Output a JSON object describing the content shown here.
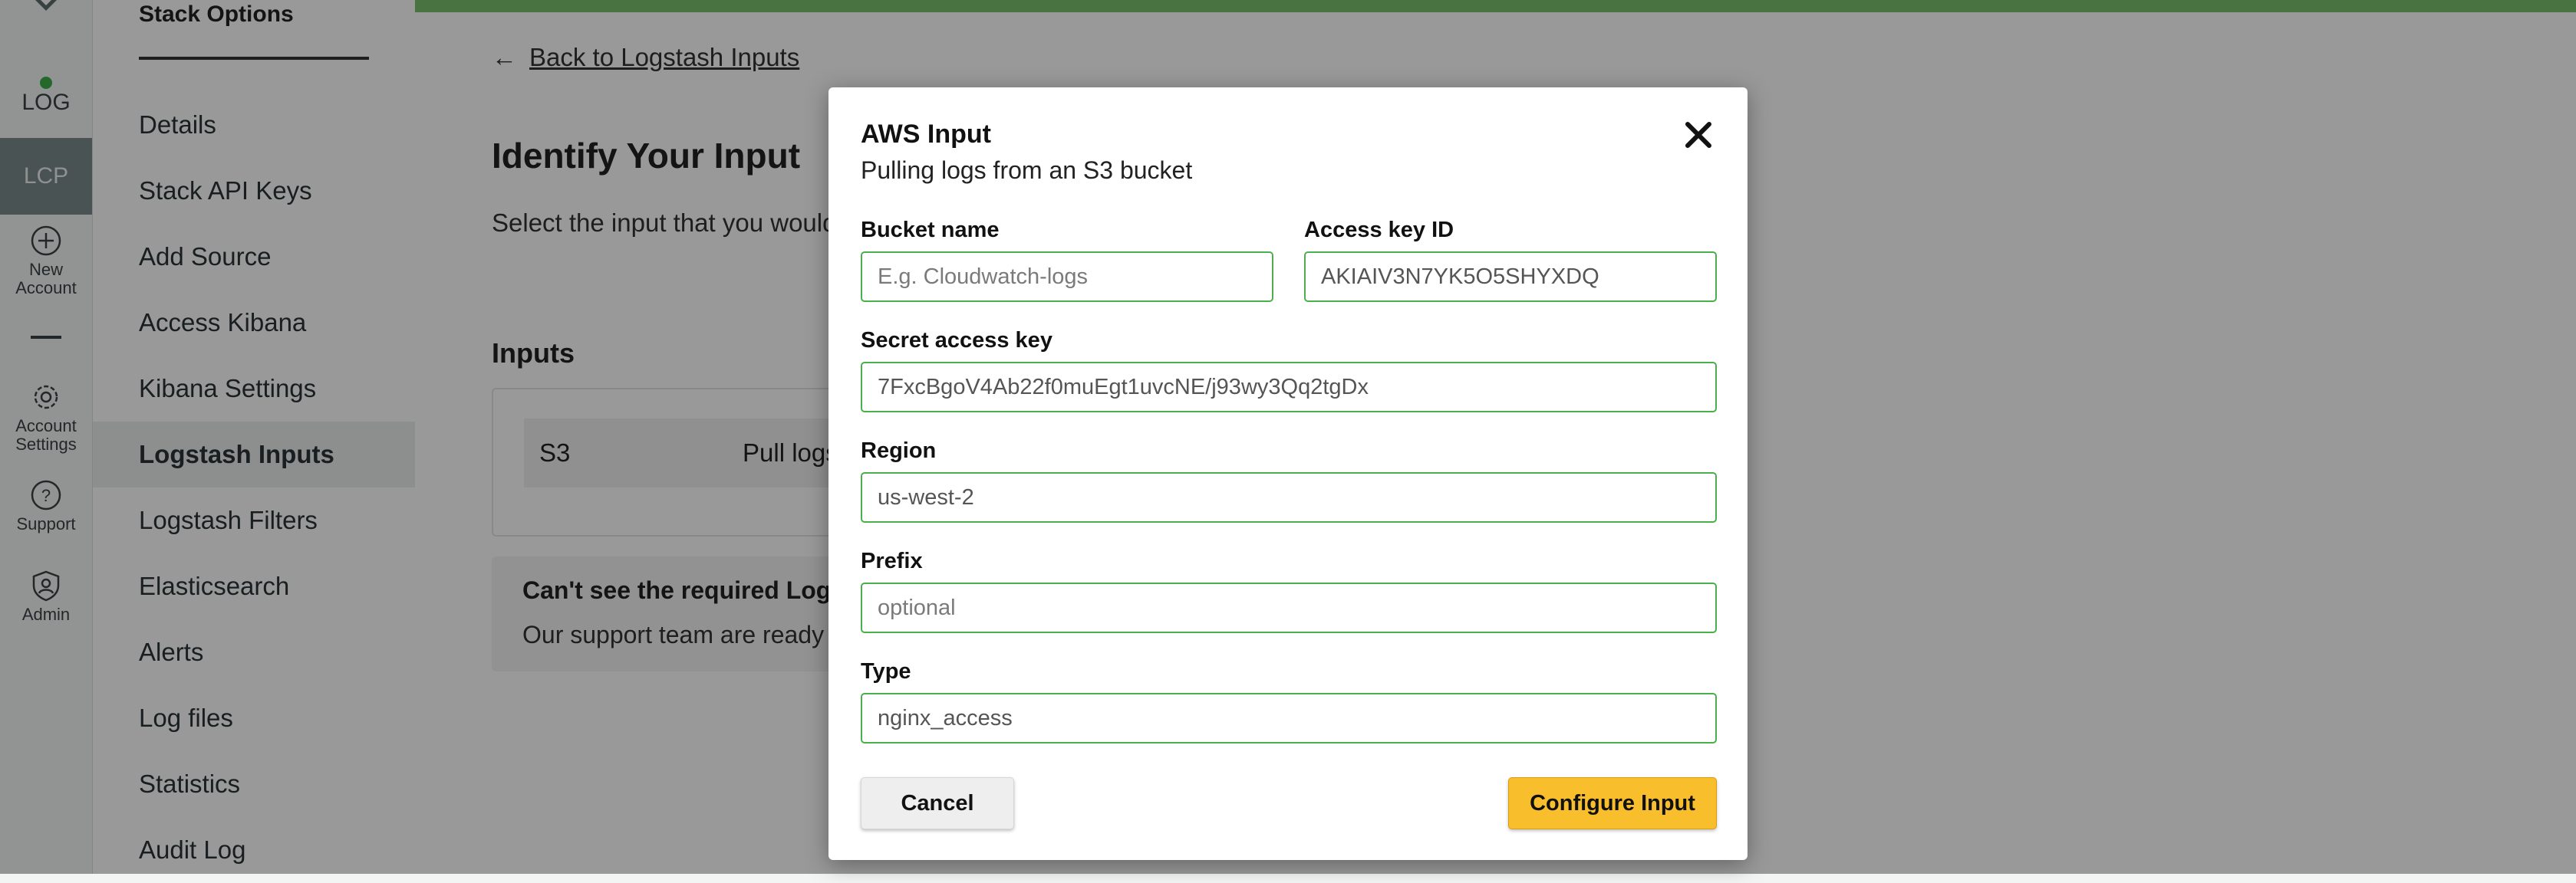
{
  "rail": {
    "log_label": "LOG",
    "lcp_label": "LCP",
    "new_account_label_1": "New",
    "new_account_label_2": "Account",
    "account_settings_label_1": "Account",
    "account_settings_label_2": "Settings",
    "support_label": "Support",
    "admin_label": "Admin",
    "status_color": "#3fae49"
  },
  "sidebar": {
    "title": "Stack Options",
    "items": [
      {
        "label": "Details"
      },
      {
        "label": "Stack API Keys"
      },
      {
        "label": "Add Source"
      },
      {
        "label": "Access Kibana"
      },
      {
        "label": "Kibana Settings"
      },
      {
        "label": "Logstash Inputs",
        "active": true
      },
      {
        "label": "Logstash Filters"
      },
      {
        "label": "Elasticsearch"
      },
      {
        "label": "Alerts"
      },
      {
        "label": "Log files"
      },
      {
        "label": "Statistics"
      },
      {
        "label": "Audit Log"
      }
    ]
  },
  "main": {
    "back_link": "Back to Logstash Inputs",
    "title": "Identify Your Input",
    "description": "Select the input that you would",
    "inputs_heading": "Inputs",
    "input_row": {
      "name": "S3",
      "desc": "Pull logs"
    },
    "help": {
      "title": "Can't see the required Logst",
      "text": "Our support team are ready t"
    },
    "accent_color": "#7bc26f"
  },
  "modal": {
    "title": "AWS Input",
    "subtitle": "Pulling logs from an S3 bucket",
    "fields": {
      "bucket": {
        "label": "Bucket name",
        "placeholder": "E.g. Cloudwatch-logs",
        "value": ""
      },
      "access_key": {
        "label": "Access key ID",
        "value": "AKIAIV3N7YK5O5SHYXDQ"
      },
      "secret_key": {
        "label": "Secret access key",
        "value": "7FxcBgoV4Ab22f0muEgt1uvcNE/j93wy3Qq2tgDx"
      },
      "region": {
        "label": "Region",
        "value": "us-west-2"
      },
      "prefix": {
        "label": "Prefix",
        "placeholder": "optional",
        "value": ""
      },
      "type": {
        "label": "Type",
        "value": "nginx_access"
      }
    },
    "cancel_label": "Cancel",
    "configure_label": "Configure Input",
    "field_border_color": "#4cae4c",
    "primary_color": "#f9be2c"
  }
}
